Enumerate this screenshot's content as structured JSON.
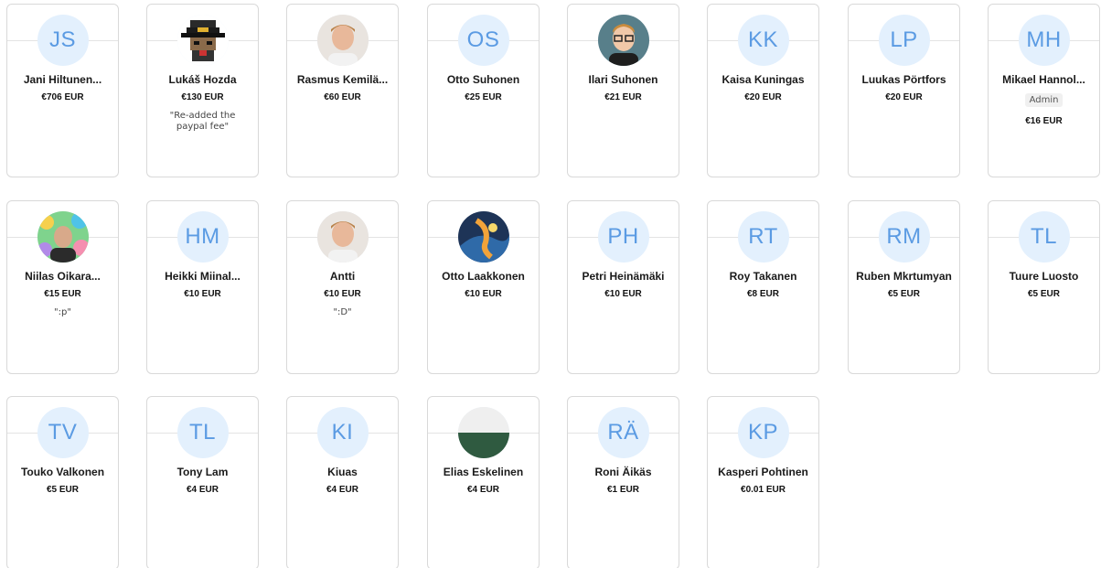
{
  "colors": {
    "avatar_bg": "#e3f0fd",
    "initials": "#5b9be3",
    "card_border": "#d9d9d9",
    "badge_bg": "#f0f0f0"
  },
  "supporters": [
    {
      "initials": "JS",
      "name": "Jani Hiltunen...",
      "amount": "€706 EUR",
      "avatar_icon": "initials"
    },
    {
      "initials": "",
      "name": "Lukáš Hozda",
      "amount": "€130 EUR",
      "message": "\"Re-added the paypal fee\"",
      "avatar_icon": "pixel-witch-photo"
    },
    {
      "initials": "",
      "name": "Rasmus Kemilä...",
      "amount": "€60 EUR",
      "avatar_icon": "person-photo"
    },
    {
      "initials": "OS",
      "name": "Otto Suhonen",
      "amount": "€25 EUR",
      "avatar_icon": "initials"
    },
    {
      "initials": "",
      "name": "Ilari Suhonen",
      "amount": "€21 EUR",
      "avatar_icon": "cartoon-person-photo"
    },
    {
      "initials": "KK",
      "name": "Kaisa Kuningas",
      "amount": "€20 EUR",
      "avatar_icon": "initials"
    },
    {
      "initials": "LP",
      "name": "Luukas Pörtfors",
      "amount": "€20 EUR",
      "avatar_icon": "initials"
    },
    {
      "initials": "MH",
      "name": "Mikael Hannol...",
      "amount": "€16 EUR",
      "badge": "Admin",
      "avatar_icon": "initials"
    },
    {
      "initials": "",
      "name": "Niilas Oikara...",
      "amount": "€15 EUR",
      "message": "\":p\"",
      "avatar_icon": "colorful-person-photo"
    },
    {
      "initials": "HM",
      "name": "Heikki Miinal...",
      "amount": "€10 EUR",
      "avatar_icon": "initials"
    },
    {
      "initials": "",
      "name": "Antti",
      "amount": "€10 EUR",
      "message": "\":D\"",
      "avatar_icon": "person-photo"
    },
    {
      "initials": "",
      "name": "Otto Laakkonen",
      "amount": "€10 EUR",
      "avatar_icon": "artwork-photo"
    },
    {
      "initials": "PH",
      "name": "Petri Heinämäki",
      "amount": "€10 EUR",
      "avatar_icon": "initials"
    },
    {
      "initials": "RT",
      "name": "Roy Takanen",
      "amount": "€8 EUR",
      "avatar_icon": "initials"
    },
    {
      "initials": "RM",
      "name": "Ruben Mkrtumyan",
      "amount": "€5 EUR",
      "avatar_icon": "initials"
    },
    {
      "initials": "TL",
      "name": "Tuure Luosto",
      "amount": "€5 EUR",
      "avatar_icon": "initials"
    },
    {
      "initials": "TV",
      "name": "Touko Valkonen",
      "amount": "€5 EUR",
      "avatar_icon": "initials"
    },
    {
      "initials": "TL",
      "name": "Tony Lam",
      "amount": "€4 EUR",
      "avatar_icon": "initials"
    },
    {
      "initials": "KI",
      "name": "Kiuas",
      "amount": "€4 EUR",
      "avatar_icon": "initials"
    },
    {
      "initials": "",
      "name": "Elias Eskelinen",
      "amount": "€4 EUR",
      "avatar_icon": "split-green-photo"
    },
    {
      "initials": "RÄ",
      "name": "Roni Äikäs",
      "amount": "€1 EUR",
      "avatar_icon": "initials"
    },
    {
      "initials": "KP",
      "name": "Kasperi Pohtinen",
      "amount": "€0.01 EUR",
      "avatar_icon": "initials"
    }
  ]
}
